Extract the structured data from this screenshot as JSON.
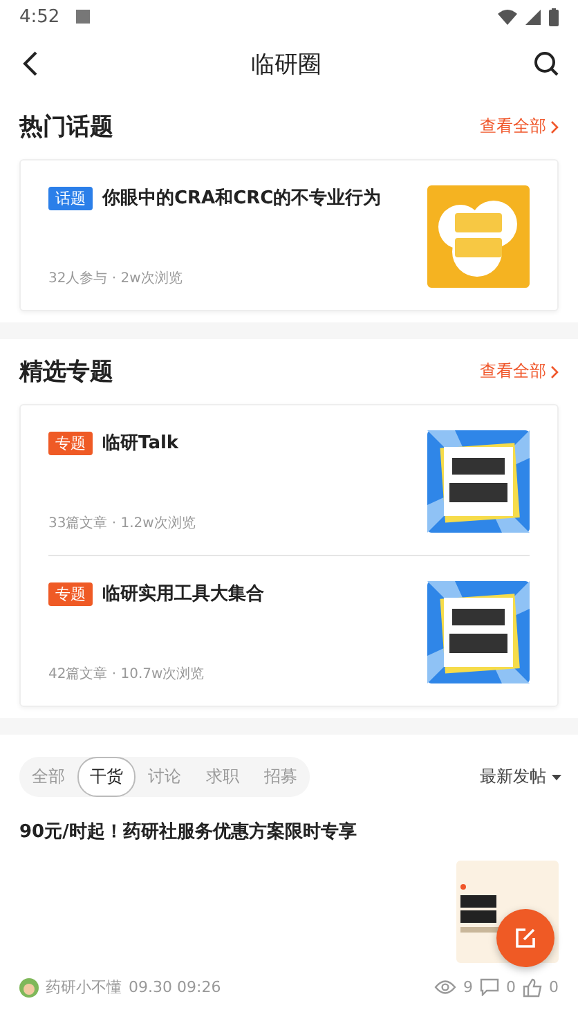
{
  "status_bar": {
    "time": "4:52"
  },
  "header": {
    "title": "临研圈"
  },
  "hot_topics": {
    "title": "热门话题",
    "more": "查看全部",
    "items": [
      {
        "tag": "话题",
        "color": "#2b7fe9",
        "title": "你眼中的CRA和CRC的不专业行为",
        "meta": "32人参与 · 2w次浏览"
      }
    ]
  },
  "featured": {
    "title": "精选专题",
    "more": "查看全部",
    "items": [
      {
        "tag": "专题",
        "color": "#ef5a25",
        "title": "临研Talk",
        "meta": "33篇文章 · 1.2w次浏览"
      },
      {
        "tag": "专题",
        "color": "#ef5a25",
        "title": "临研实用工具大集合",
        "meta": "42篇文章 · 10.7w次浏览"
      }
    ]
  },
  "filter_tabs": [
    {
      "label": "全部",
      "selected": false
    },
    {
      "label": "干货",
      "selected": true
    },
    {
      "label": "讨论",
      "selected": false
    },
    {
      "label": "求职",
      "selected": false
    },
    {
      "label": "招募",
      "selected": false
    }
  ],
  "sort": {
    "label": "最新发帖"
  },
  "post": {
    "title": "90元/时起！药研社服务优惠方案限时专享",
    "author": "药研小不懂",
    "time": "09.30 09:26",
    "views": "9",
    "comments": "0",
    "likes": "0"
  }
}
